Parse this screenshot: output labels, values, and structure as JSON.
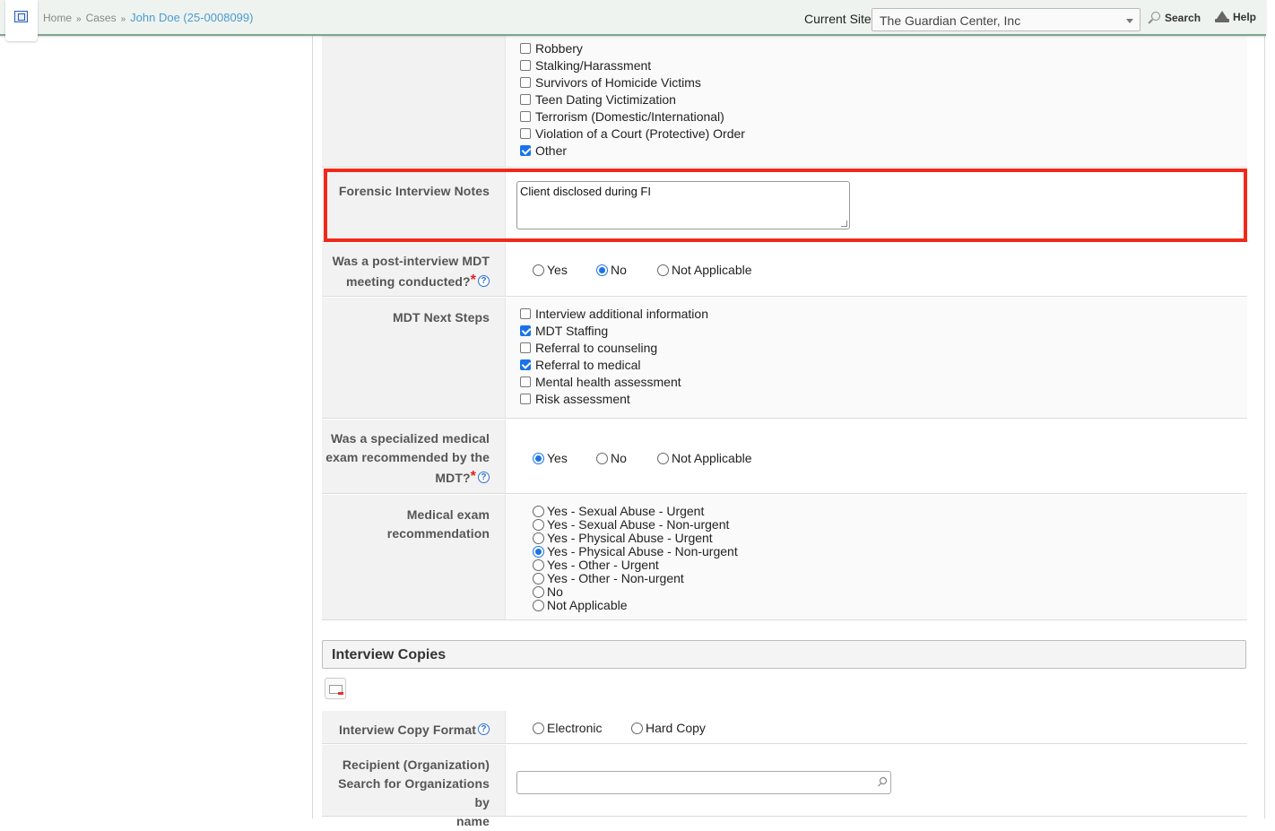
{
  "breadcrumb": {
    "home": "Home",
    "cases": "Cases",
    "current": "John Doe (25-0008099)",
    "separator": "»"
  },
  "header": {
    "site_label": "Current Site",
    "site_value": "The Guardian Center, Inc",
    "search_label": "Search",
    "help_label": "Help"
  },
  "victimization": {
    "options": [
      {
        "label": "Robbery",
        "checked": false
      },
      {
        "label": "Stalking/Harassment",
        "checked": false
      },
      {
        "label": "Survivors of Homicide Victims",
        "checked": false
      },
      {
        "label": "Teen Dating Victimization",
        "checked": false
      },
      {
        "label": "Terrorism (Domestic/International)",
        "checked": false
      },
      {
        "label": "Violation of a Court (Protective) Order",
        "checked": false
      },
      {
        "label": "Other",
        "checked": true
      }
    ]
  },
  "forensic_notes": {
    "label": "Forensic Interview Notes",
    "value": "Client disclosed during FI"
  },
  "mdt_meeting": {
    "label_line1": "Was a post-interview MDT",
    "label_line2": "meeting conducted?",
    "required_mark": "*",
    "help_mark": "?",
    "options": [
      "Yes",
      "No",
      "Not Applicable"
    ],
    "selected": "No"
  },
  "mdt_next_steps": {
    "label": "MDT Next Steps",
    "options": [
      {
        "label": "Interview additional information",
        "checked": false
      },
      {
        "label": "MDT Staffing",
        "checked": true
      },
      {
        "label": "Referral to counseling",
        "checked": false
      },
      {
        "label": "Referral to medical",
        "checked": true
      },
      {
        "label": "Mental health assessment",
        "checked": false
      },
      {
        "label": "Risk assessment",
        "checked": false
      }
    ]
  },
  "medical_exam": {
    "label_line1": "Was a specialized medical",
    "label_line2": "exam recommended by the",
    "label_line3": "MDT?",
    "required_mark": "*",
    "help_mark": "?",
    "options": [
      "Yes",
      "No",
      "Not Applicable"
    ],
    "selected": "Yes"
  },
  "exam_recommendation": {
    "label_line1": "Medical exam",
    "label_line2": "recommendation",
    "options": [
      "Yes - Sexual Abuse - Urgent",
      "Yes - Sexual Abuse - Non-urgent",
      "Yes - Physical Abuse - Urgent",
      "Yes - Physical Abuse - Non-urgent",
      "Yes - Other - Urgent",
      "Yes - Other - Non-urgent",
      "No",
      "Not Applicable"
    ],
    "selected": "Yes - Physical Abuse - Non-urgent"
  },
  "interview_copies": {
    "title": "Interview Copies",
    "format_label": "Interview Copy Format",
    "help_mark": "?",
    "format_options": [
      "Electronic",
      "Hard Copy"
    ],
    "recipient_label_line1": "Recipient (Organization)",
    "recipient_label_line2": "Search for Organizations by",
    "recipient_label_line3": "name",
    "recipient_value": ""
  },
  "colors": {
    "highlight": "#ee2a1b",
    "accent": "#1a73e8",
    "required": "#e02020",
    "breadcrumb_link": "#4b9bd0"
  }
}
